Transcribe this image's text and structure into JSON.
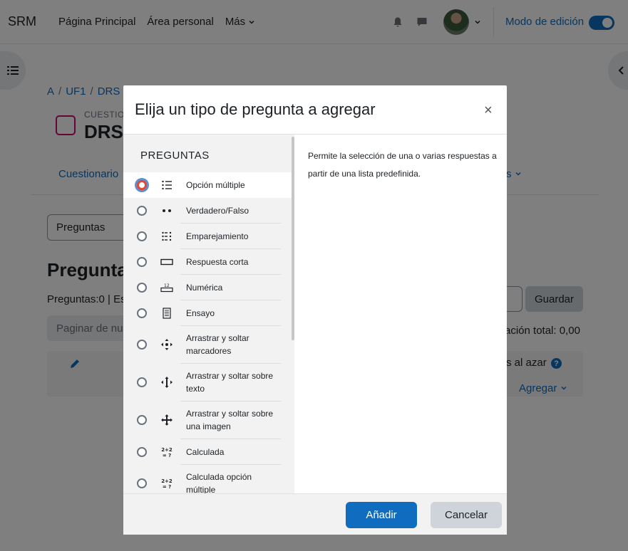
{
  "navbar": {
    "brand": "SRM",
    "links": [
      "Página Principal",
      "Área personal",
      "Más"
    ],
    "edit_mode_label": "Modo de edición",
    "edit_mode_on": true
  },
  "page": {
    "breadcrumb": [
      "A",
      "UF1",
      "DRS"
    ],
    "quiz_kind": "CUESTIO",
    "quiz_title": "DRS",
    "tab_quiz": "Cuestionario",
    "tab_more": "s",
    "select_value": "Preguntas",
    "heading": "Pregunta",
    "question_count": "Preguntas:0 | Es",
    "save_label": "Guardar",
    "paginate_label": "Paginar de nu",
    "total_grade": "ación total: 0,00",
    "random_label": "s al azar",
    "help_icon": "?",
    "add_label": "Agregar"
  },
  "modal": {
    "title": "Elija un tipo de pregunta a agregar",
    "close_symbol": "×",
    "section_heading": "PREGUNTAS",
    "options": [
      {
        "label": "Opción múltiple",
        "icon": "list-icon",
        "selected": true
      },
      {
        "label": "Verdadero/Falso",
        "icon": "two-dots-icon",
        "selected": false
      },
      {
        "label": "Emparejamiento",
        "icon": "matching-icon",
        "selected": false
      },
      {
        "label": "Respuesta corta",
        "icon": "short-answer-icon",
        "selected": false
      },
      {
        "label": "Numérica",
        "icon": "numeric-icon",
        "selected": false
      },
      {
        "label": "Ensayo",
        "icon": "essay-icon",
        "selected": false
      },
      {
        "label": "Arrastrar y soltar marcadores",
        "icon": "drag-markers-icon",
        "selected": false
      },
      {
        "label": "Arrastrar y soltar sobre texto",
        "icon": "drag-text-icon",
        "selected": false
      },
      {
        "label": "Arrastrar y soltar sobre una imagen",
        "icon": "drag-image-icon",
        "selected": false
      },
      {
        "label": "Calculada",
        "icon": "calculated-icon",
        "selected": false
      },
      {
        "label": "Calculada opción múltiple",
        "icon": "calculated-multi-icon",
        "selected": false
      }
    ],
    "description": "Permite la selección de una o varias respuestas a partir de una lista predefinida.",
    "add_button": "Añadir",
    "cancel_button": "Cancelar",
    "numeric_icon_text": "12",
    "calc_icon_text": "2+2 = ?"
  },
  "colors": {
    "primary": "#0f6cbf",
    "quiz_icon": "#c80e6b",
    "backdrop": "rgba(0,0,0,0.5)"
  }
}
